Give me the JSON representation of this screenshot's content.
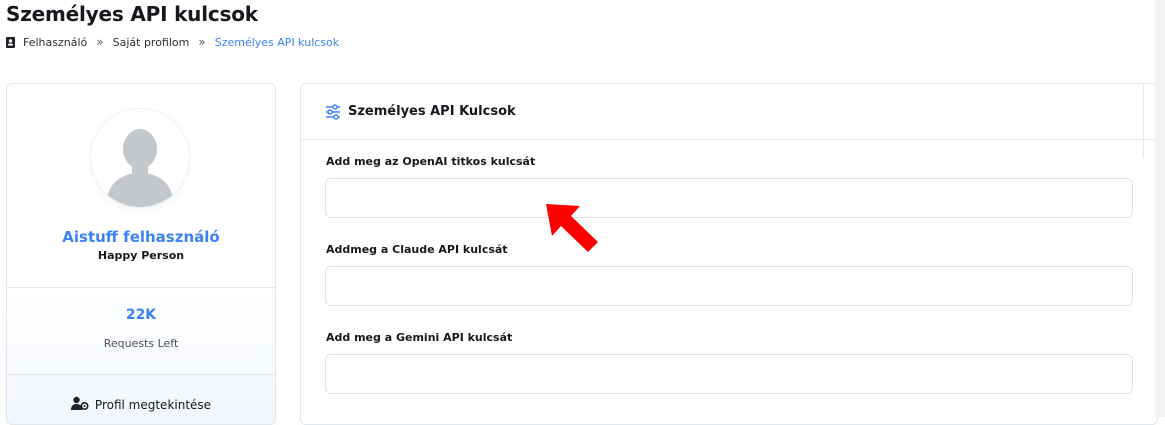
{
  "page": {
    "title": "Személyes API kulcsok"
  },
  "breadcrumb": {
    "icon": "id-card-icon",
    "items": [
      "Felhasználó",
      "Saját profilom",
      "Személyes API kulcsok"
    ],
    "separator": "»"
  },
  "profile": {
    "avatar_icon": "user-avatar-icon",
    "name": "Aistuff felhasználó",
    "subtitle": "Happy Person",
    "stat_value": "22K",
    "stat_label": "Requests Left",
    "view_profile_label": "Profil megtekintése",
    "view_profile_icon": "user-cog-icon"
  },
  "api_keys": {
    "header_icon": "sliders-icon",
    "title": "Személyes API Kulcsok",
    "fields": [
      {
        "label": "Add meg az OpenAI titkos kulcsát",
        "value": "",
        "placeholder": ""
      },
      {
        "label": "Addmeg a Claude API kulcsát",
        "value": "",
        "placeholder": ""
      },
      {
        "label": "Add meg a Gemini API kulcsát",
        "value": "",
        "placeholder": ""
      }
    ]
  },
  "colors": {
    "accent": "#3b82f6",
    "annotation_arrow": "#ff0000",
    "border": "#e3e6ea"
  }
}
